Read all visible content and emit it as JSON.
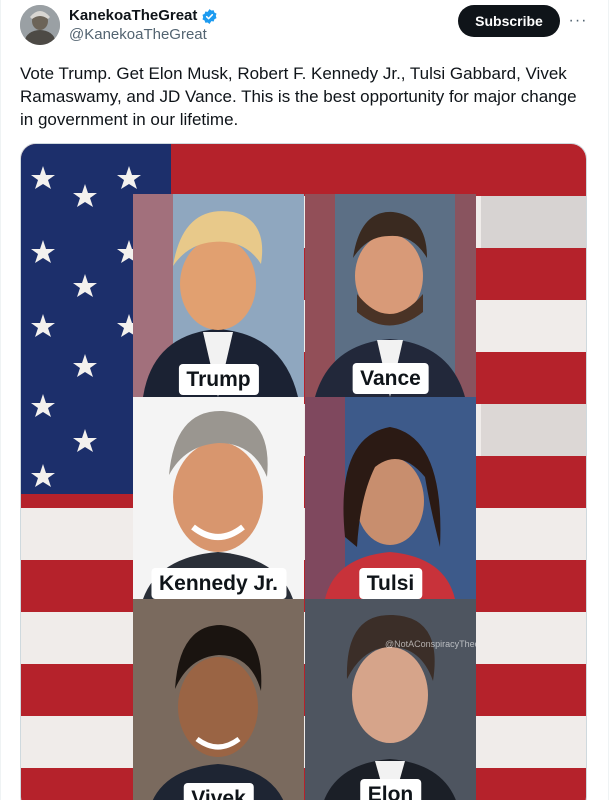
{
  "author": {
    "display_name": "KanekoaTheGreat",
    "handle": "@KanekoaTheGreat",
    "verified_icon": "verified-badge-icon",
    "avatar_icon": "avatar-image"
  },
  "actions": {
    "subscribe_label": "Subscribe",
    "more_icon": "more-options-icon",
    "more_glyph": "···"
  },
  "tweet": {
    "text": "Vote Trump. Get Elon Musk, Robert F. Kennedy Jr., Tulsi Gabbard, Vivek Ramaswamy, and JD Vance. This is the best opportunity for major change in government in our lifetime."
  },
  "media": {
    "background": "american-flag",
    "labels": {
      "trump": "Trump",
      "vance": "Vance",
      "kennedy": "Kennedy Jr.",
      "tulsi": "Tulsi",
      "vivek": "Vivek",
      "elon": "Elon"
    },
    "watermark": "@NotAConspiracyTheory"
  },
  "colors": {
    "accent_blue": "#1d9bf0",
    "text_primary": "#0f1419",
    "text_secondary": "#536471",
    "flag_red": "#b5222b",
    "flag_blue": "#1c2f6b"
  }
}
